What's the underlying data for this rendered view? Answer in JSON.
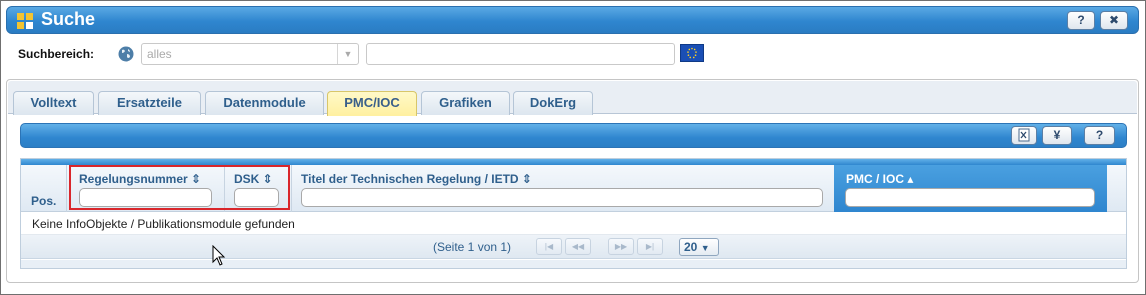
{
  "window": {
    "title": "Suche",
    "help_button": "?",
    "close_button": "✖"
  },
  "search": {
    "label": "Suchbereich:",
    "scope_value": "alles",
    "text_value": ""
  },
  "tabs": [
    {
      "label": "Volltext",
      "active": false
    },
    {
      "label": "Ersatzteile",
      "active": false
    },
    {
      "label": "Datenmodule",
      "active": false
    },
    {
      "label": "PMC/IOC",
      "active": true
    },
    {
      "label": "Grafiken",
      "active": false
    },
    {
      "label": "DokErg",
      "active": false
    }
  ],
  "toolbar": {
    "yen_label": "¥",
    "help_label": "?"
  },
  "grid": {
    "columns": {
      "pos": "Pos.",
      "regelungsnummer": "Regelungsnummer ⇕",
      "dsk": "DSK ⇕",
      "titel": "Titel der Technischen Regelung / IETD ⇕",
      "pmc_ioc": "PMC / IOC ▴"
    },
    "empty_message": "Keine InfoObjekte / Publikationsmodule gefunden",
    "pager": {
      "page_info": "(Seite 1 von 1)",
      "page_size": "20"
    }
  },
  "colors": {
    "accent_blue": "#2f86cf",
    "active_tab": "#fff0a0",
    "highlight_red": "#d9262b"
  }
}
